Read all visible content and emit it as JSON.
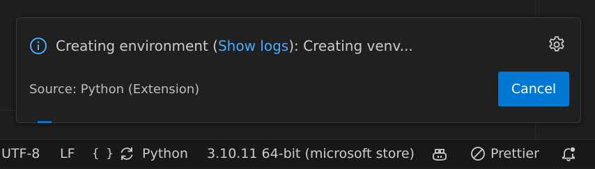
{
  "notification": {
    "message_prefix": "Creating environment (",
    "link_text": "Show logs",
    "message_suffix": "): Creating venv...",
    "source": "Source: Python (Extension)",
    "cancel_label": "Cancel",
    "icons": {
      "info": "info-icon",
      "settings": "gear-icon"
    }
  },
  "statusbar": {
    "encoding": "UTF-8",
    "eol": "LF",
    "language_icon": "{ }",
    "language": "Python",
    "interpreter": "3.10.11 64-bit (microsoft store)",
    "formatter": "Prettier",
    "icons": {
      "sync": "sync-icon",
      "copilot": "copilot-icon",
      "prettier": "circle-slash-icon",
      "notifications": "bell-dot-icon"
    }
  },
  "colors": {
    "accent": "#0078d4",
    "link": "#4daafc",
    "background": "#1f1f1f",
    "statusbar": "#181818"
  }
}
